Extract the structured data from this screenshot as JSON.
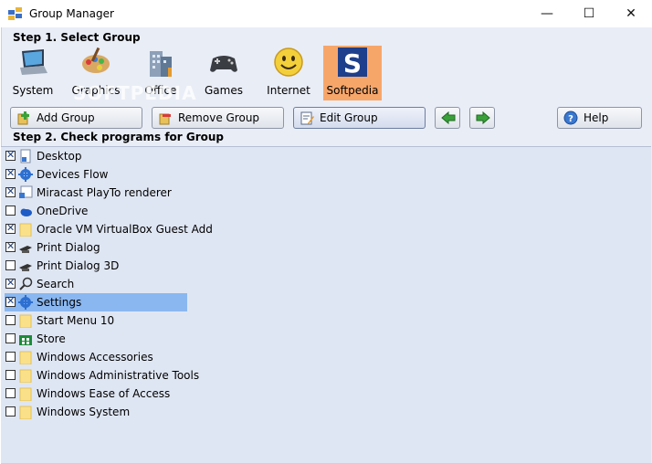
{
  "window": {
    "title": "Group Manager",
    "controls": {
      "minimize": "—",
      "maximize": "☐",
      "close": "✕"
    }
  },
  "step1": {
    "label": "Step 1. Select Group"
  },
  "groups": [
    {
      "label": "System",
      "icon": "laptop-icon"
    },
    {
      "label": "Graphics",
      "icon": "palette-icon"
    },
    {
      "label": "Office",
      "icon": "office-building-icon"
    },
    {
      "label": "Games",
      "icon": "gamepad-icon"
    },
    {
      "label": "Internet",
      "icon": "smiley-icon"
    },
    {
      "label": "Softpedia",
      "icon": "softpedia-logo-icon",
      "selected": true
    }
  ],
  "watermark": "SOFTPEDIA",
  "toolbar": {
    "add_label": "Add Group",
    "remove_label": "Remove Group",
    "edit_label": "Edit Group",
    "help_label": "Help"
  },
  "step2": {
    "label": "Step 2. Check programs for Group"
  },
  "programs": [
    {
      "label": "Desktop",
      "checked": true,
      "icon": "desktop-shortcut-icon"
    },
    {
      "label": "Devices Flow",
      "checked": true,
      "icon": "gear-icon"
    },
    {
      "label": "Miracast PlayTo renderer",
      "checked": true,
      "icon": "shortcut-icon"
    },
    {
      "label": "OneDrive",
      "checked": false,
      "icon": "cloud-icon"
    },
    {
      "label": "Oracle VM VirtualBox Guest Add",
      "checked": true,
      "icon": "folder-icon"
    },
    {
      "label": "Print Dialog",
      "checked": true,
      "icon": "printer-icon"
    },
    {
      "label": "Print Dialog 3D",
      "checked": false,
      "icon": "printer-icon"
    },
    {
      "label": "Search",
      "checked": true,
      "icon": "search-icon"
    },
    {
      "label": "Settings",
      "checked": true,
      "icon": "gear-icon",
      "selected": true
    },
    {
      "label": "Start Menu 10",
      "checked": false,
      "icon": "folder-icon"
    },
    {
      "label": "Store",
      "checked": false,
      "icon": "store-icon"
    },
    {
      "label": "Windows Accessories",
      "checked": false,
      "icon": "folder-icon"
    },
    {
      "label": "Windows Administrative Tools",
      "checked": false,
      "icon": "folder-icon"
    },
    {
      "label": "Windows Ease of Access",
      "checked": false,
      "icon": "folder-icon"
    },
    {
      "label": "Windows System",
      "checked": false,
      "icon": "folder-icon"
    }
  ],
  "colors": {
    "accent_selected_group": "#f7a66a",
    "list_selection": "#8ab7f0",
    "list_background": "#dfe6f3"
  }
}
